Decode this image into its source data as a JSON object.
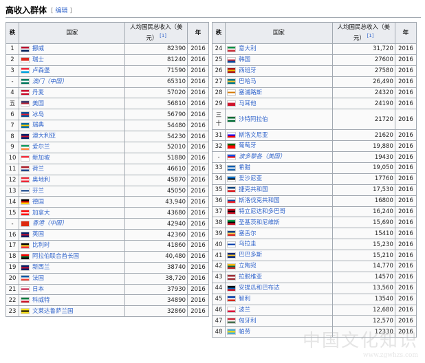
{
  "section": {
    "title": "高收入群体",
    "edit_open": "[",
    "edit_label": "编辑",
    "edit_close": "]"
  },
  "headers": {
    "rank": "秩",
    "country": "国家",
    "income": "人均国民总收入（美元）",
    "ref": "[1]",
    "year": "年"
  },
  "left_rows": [
    {
      "rank": "1",
      "country": "挪威",
      "value": "82390",
      "year": "2016",
      "flag": [
        "#ba0c2f",
        "#ffffff",
        "#00205b"
      ]
    },
    {
      "rank": "2",
      "country": "瑞士",
      "value": "81240",
      "year": "2016",
      "flag": [
        "#da291c",
        "#da291c",
        "#ffffff"
      ]
    },
    {
      "rank": "3",
      "country": "卢森堡",
      "value": "71590",
      "year": "2016",
      "flag": [
        "#ed2939",
        "#ffffff",
        "#00a1de"
      ]
    },
    {
      "rank": "-",
      "country": "澳门（中国）",
      "value": "65310",
      "year": "2016",
      "flag": [
        "#00785e",
        "#ffffff",
        "#00785e"
      ],
      "italic": true
    },
    {
      "rank": "4",
      "country": "丹麦",
      "value": "57020",
      "year": "2016",
      "flag": [
        "#c8102e",
        "#ffffff",
        "#c8102e"
      ]
    },
    {
      "rank": "五",
      "country": "美国",
      "value": "56810",
      "year": "2016",
      "flag": [
        "#3c3b6e",
        "#b22234",
        "#ffffff"
      ]
    },
    {
      "rank": "6",
      "country": "冰岛",
      "value": "56790",
      "year": "2016",
      "flag": [
        "#02529c",
        "#dc1e35",
        "#02529c"
      ]
    },
    {
      "rank": "7",
      "country": "瑞典",
      "value": "54480",
      "year": "2016",
      "flag": [
        "#006aa7",
        "#fecc00",
        "#006aa7"
      ]
    },
    {
      "rank": "8",
      "country": "澳大利亚",
      "value": "54230",
      "year": "2016",
      "flag": [
        "#012169",
        "#c8102e",
        "#012169"
      ]
    },
    {
      "rank": "9",
      "country": "爱尔兰",
      "value": "52010",
      "year": "2016",
      "flag": [
        "#169b62",
        "#ffffff",
        "#ff883e"
      ]
    },
    {
      "rank": "10",
      "country": "新加坡",
      "value": "51880",
      "year": "2016",
      "flag": [
        "#ef3340",
        "#ffffff",
        "#ffffff"
      ]
    },
    {
      "rank": "11",
      "country": "荷兰",
      "value": "46610",
      "year": "2016",
      "flag": [
        "#ae1c28",
        "#ffffff",
        "#21468b"
      ]
    },
    {
      "rank": "12",
      "country": "奥地利",
      "value": "45870",
      "year": "2016",
      "flag": [
        "#ed2939",
        "#ffffff",
        "#ed2939"
      ]
    },
    {
      "rank": "13",
      "country": "芬兰",
      "value": "45050",
      "year": "2016",
      "flag": [
        "#ffffff",
        "#003580",
        "#ffffff"
      ]
    },
    {
      "rank": "14",
      "country": "德国",
      "value": "43,940",
      "year": "2016",
      "flag": [
        "#000000",
        "#dd0000",
        "#ffce00"
      ]
    },
    {
      "rank": "15",
      "country": "加拿大",
      "value": "43680",
      "year": "2016",
      "flag": [
        "#ff0000",
        "#ffffff",
        "#ff0000"
      ]
    },
    {
      "rank": "-",
      "country": "香港（中国）",
      "value": "42940",
      "year": "2016",
      "flag": [
        "#de2910",
        "#de2910",
        "#de2910"
      ],
      "italic": true
    },
    {
      "rank": "16",
      "country": "英国",
      "value": "42360",
      "year": "2016",
      "flag": [
        "#012169",
        "#c8102e",
        "#012169"
      ]
    },
    {
      "rank": "17",
      "country": "比利时",
      "value": "41860",
      "year": "2016",
      "flag": [
        "#000000",
        "#fdda24",
        "#ef3340"
      ]
    },
    {
      "rank": "18",
      "country": "阿拉伯联合酋长国",
      "value": "40,480",
      "year": "2016",
      "flag": [
        "#ff0000",
        "#00732f",
        "#000000"
      ]
    },
    {
      "rank": "19",
      "country": "新西兰",
      "value": "38740",
      "year": "2016",
      "flag": [
        "#012169",
        "#c8102e",
        "#012169"
      ]
    },
    {
      "rank": "20",
      "country": "法国",
      "value": "38,720",
      "year": "2016",
      "flag": [
        "#0055a4",
        "#ffffff",
        "#ef4135"
      ]
    },
    {
      "rank": "21",
      "country": "日本",
      "value": "37930",
      "year": "2016",
      "flag": [
        "#ffffff",
        "#bc002d",
        "#ffffff"
      ]
    },
    {
      "rank": "22",
      "country": "科威特",
      "value": "34890",
      "year": "2016",
      "flag": [
        "#007a3d",
        "#ffffff",
        "#ce1126"
      ]
    },
    {
      "rank": "23",
      "country": "文莱达鲁萨兰国",
      "value": "32860",
      "year": "2016",
      "flag": [
        "#f7e017",
        "#000000",
        "#f7e017"
      ]
    }
  ],
  "right_rows": [
    {
      "rank": "24",
      "country": "意大利",
      "value": "31,720",
      "year": "2016",
      "flag": [
        "#009246",
        "#ffffff",
        "#ce2b37"
      ]
    },
    {
      "rank": "25",
      "country": "韩国",
      "value": "27600",
      "year": "2016",
      "flag": [
        "#ffffff",
        "#cd2e3a",
        "#0047a0"
      ]
    },
    {
      "rank": "26",
      "country": "西班牙",
      "value": "27580",
      "year": "2016",
      "flag": [
        "#aa151b",
        "#f1bf00",
        "#aa151b"
      ]
    },
    {
      "rank": "27",
      "country": "巴哈马",
      "value": "26,490",
      "year": "2016",
      "flag": [
        "#00778b",
        "#ffc72c",
        "#00778b"
      ]
    },
    {
      "rank": "28",
      "country": "塞浦路斯",
      "value": "24320",
      "year": "2016",
      "flag": [
        "#ffffff",
        "#d57800",
        "#ffffff"
      ]
    },
    {
      "rank": "29",
      "country": "马耳他",
      "value": "24190",
      "year": "2016",
      "flag": [
        "#ffffff",
        "#cf142b",
        "#cf142b"
      ]
    },
    {
      "rank": "三十",
      "country": "沙特阿拉伯",
      "value": "21720",
      "year": "2016",
      "flag": [
        "#006c35",
        "#ffffff",
        "#006c35"
      ]
    },
    {
      "rank": "31",
      "country": "斯洛文尼亚",
      "value": "21620",
      "year": "2016",
      "flag": [
        "#ffffff",
        "#0000ff",
        "#ff0000"
      ]
    },
    {
      "rank": "32",
      "country": "葡萄牙",
      "value": "19,880",
      "year": "2016",
      "flag": [
        "#006600",
        "#ff0000",
        "#ff0000"
      ]
    },
    {
      "rank": "-",
      "country": "波多黎各（美国）",
      "value": "19430",
      "year": "2016",
      "flag": [
        "#0050f0",
        "#ed0000",
        "#ffffff"
      ],
      "italic": true
    },
    {
      "rank": "33",
      "country": "希腊",
      "value": "19,050",
      "year": "2016",
      "flag": [
        "#0d5eaf",
        "#ffffff",
        "#0d5eaf"
      ]
    },
    {
      "rank": "34",
      "country": "爱沙尼亚",
      "value": "17760",
      "year": "2016",
      "flag": [
        "#0072ce",
        "#000000",
        "#ffffff"
      ]
    },
    {
      "rank": "35",
      "country": "捷克共和国",
      "value": "17,530",
      "year": "2016",
      "flag": [
        "#11457e",
        "#ffffff",
        "#d7141a"
      ]
    },
    {
      "rank": "36",
      "country": "斯洛伐克共和国",
      "value": "16800",
      "year": "2016",
      "flag": [
        "#ffffff",
        "#0b4ea2",
        "#ee1c25"
      ]
    },
    {
      "rank": "37",
      "country": "特立尼达和多巴哥",
      "value": "16,240",
      "year": "2016",
      "flag": [
        "#ce1126",
        "#000000",
        "#ce1126"
      ]
    },
    {
      "rank": "38",
      "country": "圣基茨和尼维斯",
      "value": "15,690",
      "year": "2016",
      "flag": [
        "#009e49",
        "#000000",
        "#ce1126"
      ]
    },
    {
      "rank": "39",
      "country": "塞舌尔",
      "value": "15410",
      "year": "2016",
      "flag": [
        "#003f87",
        "#fcd856",
        "#d62828"
      ]
    },
    {
      "rank": "40",
      "country": "乌拉圭",
      "value": "15,230",
      "year": "2016",
      "flag": [
        "#ffffff",
        "#0038a8",
        "#ffffff"
      ]
    },
    {
      "rank": "41",
      "country": "巴巴多斯",
      "value": "15,210",
      "year": "2016",
      "flag": [
        "#00267f",
        "#ffc726",
        "#00267f"
      ]
    },
    {
      "rank": "42",
      "country": "立陶宛",
      "value": "14,770",
      "year": "2016",
      "flag": [
        "#fdb913",
        "#006a44",
        "#c1272d"
      ]
    },
    {
      "rank": "43",
      "country": "拉脱维亚",
      "value": "14570",
      "year": "2016",
      "flag": [
        "#9e3039",
        "#ffffff",
        "#9e3039"
      ]
    },
    {
      "rank": "44",
      "country": "安提瓜和巴布达",
      "value": "13,560",
      "year": "2016",
      "flag": [
        "#000000",
        "#0072c6",
        "#ce1126"
      ]
    },
    {
      "rank": "45",
      "country": "智利",
      "value": "13540",
      "year": "2016",
      "flag": [
        "#0039a6",
        "#ffffff",
        "#d52b1e"
      ]
    },
    {
      "rank": "46",
      "country": "波兰",
      "value": "12,680",
      "year": "2016",
      "flag": [
        "#ffffff",
        "#ffffff",
        "#dc143c"
      ]
    },
    {
      "rank": "47",
      "country": "匈牙利",
      "value": "12,570",
      "year": "2016",
      "flag": [
        "#ce2939",
        "#ffffff",
        "#477050"
      ]
    },
    {
      "rank": "48",
      "country": "帕劳",
      "value": "12330",
      "year": "2016",
      "flag": [
        "#4aadd6",
        "#ffde00",
        "#4aadd6"
      ]
    }
  ],
  "watermark": {
    "text": "中国文化知识",
    "sub": "www.zgwhzs.com"
  }
}
